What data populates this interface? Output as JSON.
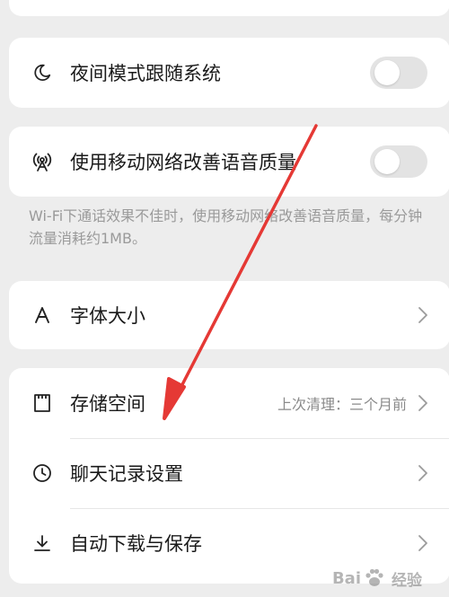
{
  "settings": {
    "night_mode_label": "夜间模式跟随系统",
    "mobile_network_label": "使用移动网络改善语音质量",
    "note_text": "Wi-Fi下通话效果不佳时，使用移动网络改善语音质量，每分钟流量消耗约1MB。",
    "font_size_label": "字体大小",
    "storage_label": "存储空间",
    "storage_value": "上次清理：三个月前",
    "chat_history_label": "聊天记录设置",
    "auto_download_label": "自动下载与保存"
  },
  "watermark": {
    "brand_left": "Bai",
    "brand_right": "经验"
  },
  "colors": {
    "background": "#ededed",
    "card": "#ffffff",
    "arrow": "#e53935",
    "toggle_off": "#e3e3e3"
  },
  "icons": [
    "moon-icon",
    "antenna-icon",
    "font-a-icon",
    "storage-icon",
    "clock-icon",
    "download-icon",
    "chevron-right-icon"
  ]
}
